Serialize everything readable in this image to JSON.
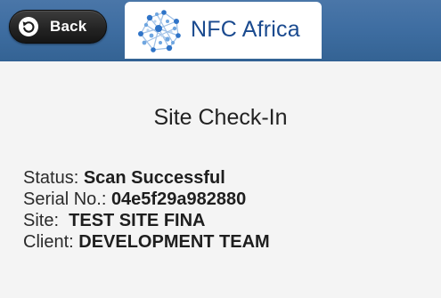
{
  "header": {
    "back_label": "Back",
    "logo_text": "NFC Africa"
  },
  "page": {
    "title": "Site Check-In"
  },
  "details": {
    "status": {
      "label": "Status: ",
      "value": "Scan Successful"
    },
    "serial": {
      "label": "Serial No.: ",
      "value": "04e5f29a982880"
    },
    "site": {
      "label": "Site:  ",
      "value": "TEST SITE FINA"
    },
    "client": {
      "label": "Client: ",
      "value": "DEVELOPMENT TEAM"
    }
  },
  "colors": {
    "header_blue": "#3f6ea2",
    "logo_blue": "#1a4a8f",
    "background": "#f4f4f4"
  },
  "icons": {
    "back": "undo-arrow-icon",
    "logo": "globe-network-icon"
  }
}
